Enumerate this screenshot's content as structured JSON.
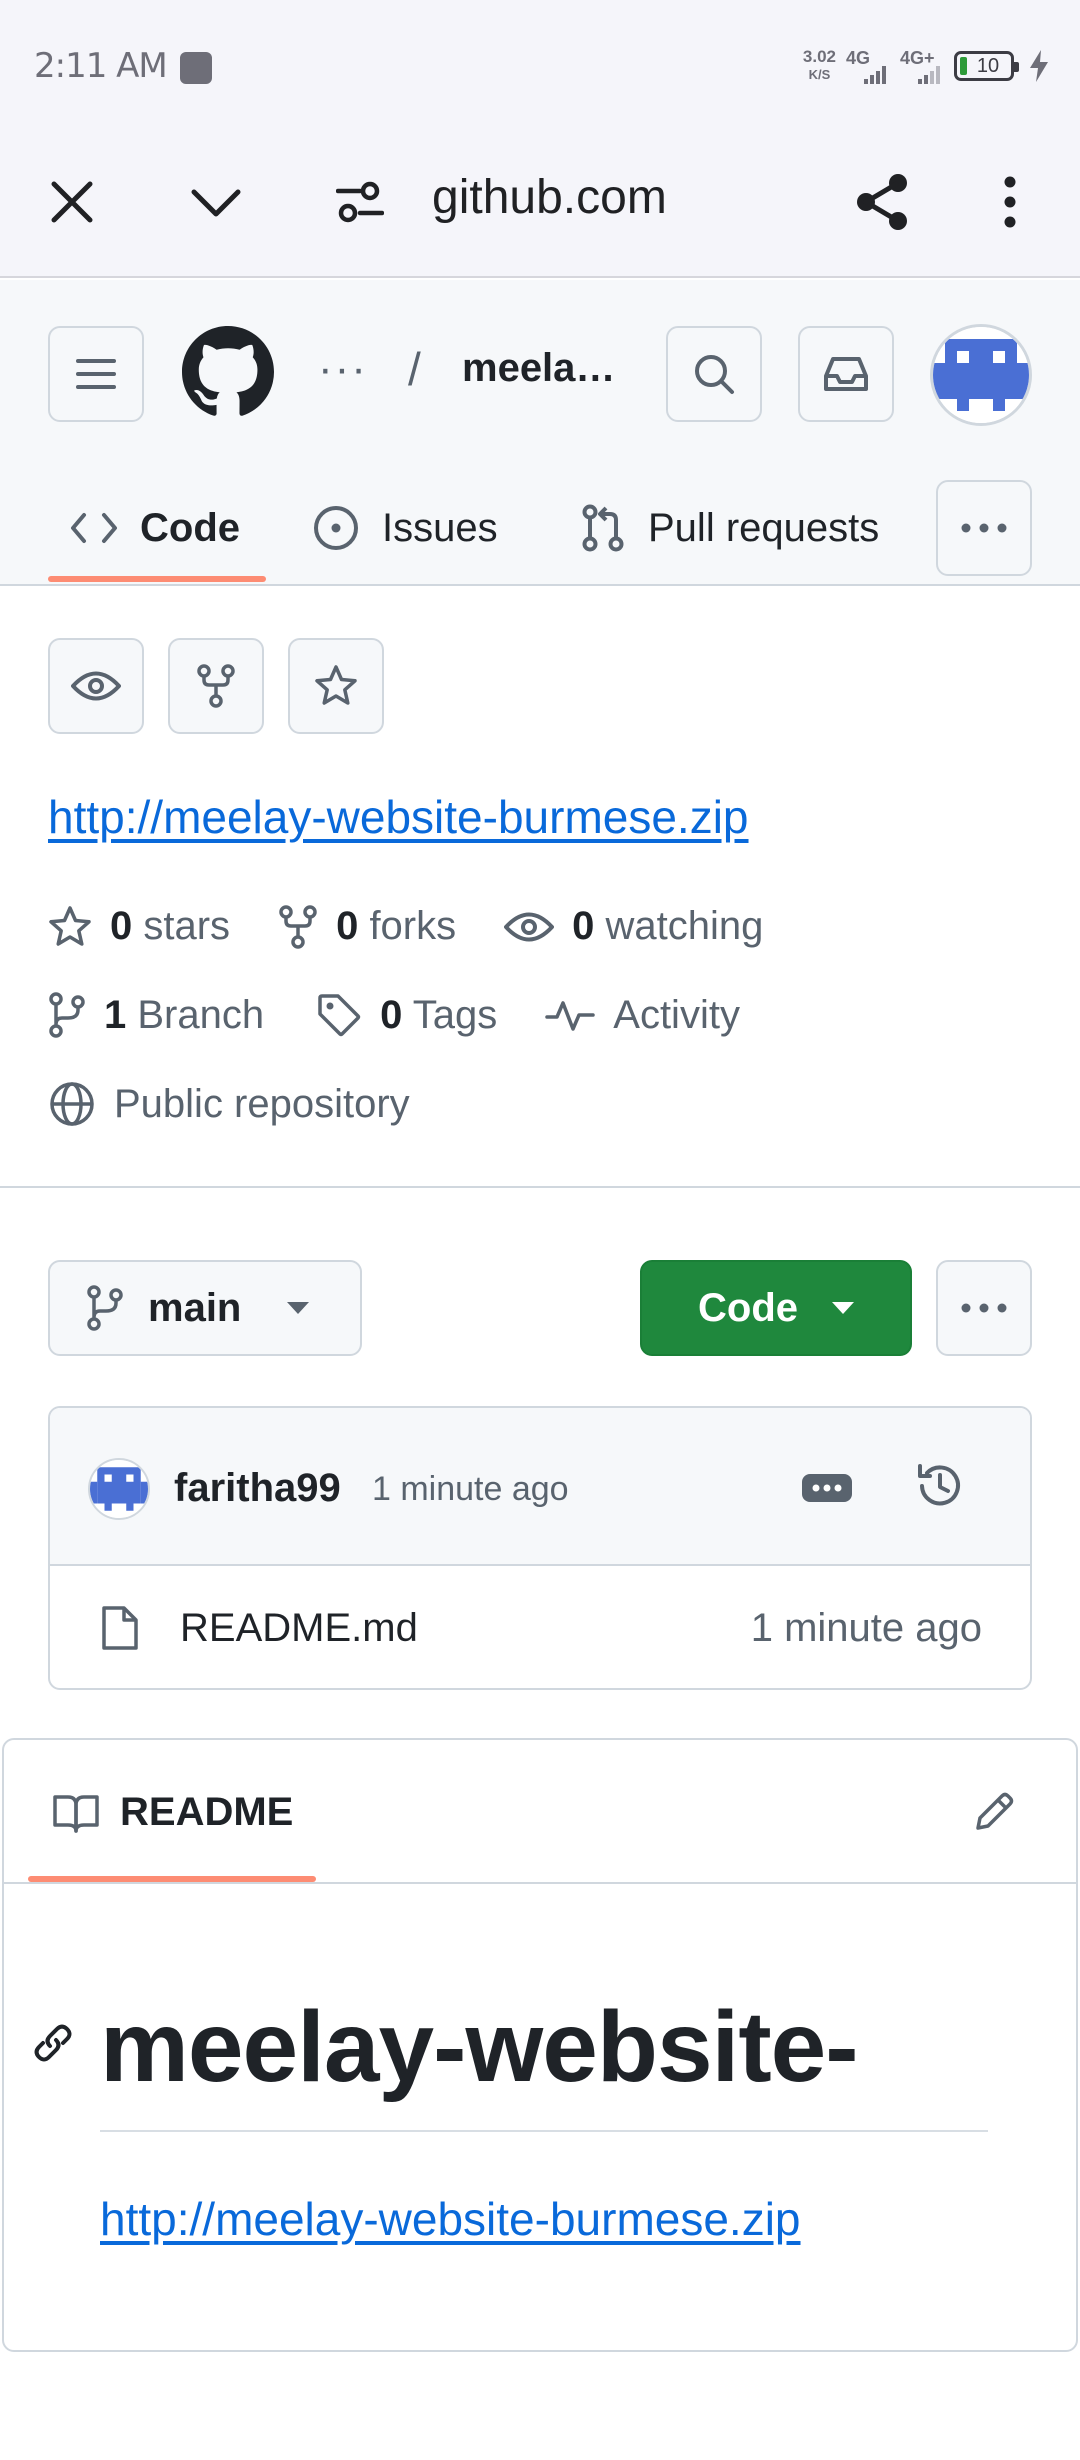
{
  "status_bar": {
    "time": "2:11 AM",
    "net_speed_value": "3.02",
    "net_speed_unit": "K/S",
    "sim1": "4G",
    "sim2": "4G+",
    "battery": "10"
  },
  "browser": {
    "url": "github.com"
  },
  "header": {
    "breadcrumb_ellipsis": "···",
    "breadcrumb_separator": "/",
    "repo_name": "meela…"
  },
  "tabs": [
    {
      "label": "Code"
    },
    {
      "label": "Issues"
    },
    {
      "label": "Pull requests"
    }
  ],
  "about": {
    "link": "http://meelay-website-burmese.zip",
    "stars_count": "0",
    "stars_label": "stars",
    "forks_count": "0",
    "forks_label": "forks",
    "watching_count": "0",
    "watching_label": "watching",
    "branch_count": "1",
    "branch_label": "Branch",
    "tags_count": "0",
    "tags_label": "Tags",
    "activity_label": "Activity",
    "visibility": "Public repository"
  },
  "toolbar": {
    "branch": "main",
    "code_button": "Code"
  },
  "latest_commit": {
    "author": "faritha99",
    "time": "1 minute ago"
  },
  "files": [
    {
      "name": "README.md",
      "time": "1 minute ago"
    }
  ],
  "readme": {
    "tab_label": "README",
    "heading": "meelay-website-",
    "link": "http://meelay-website-burmese.zip"
  },
  "colors": {
    "accent_underline": "#fd8c73",
    "primary_button": "#1f883d",
    "link": "#0969da",
    "avatar_blue": "#4a6fd4"
  }
}
